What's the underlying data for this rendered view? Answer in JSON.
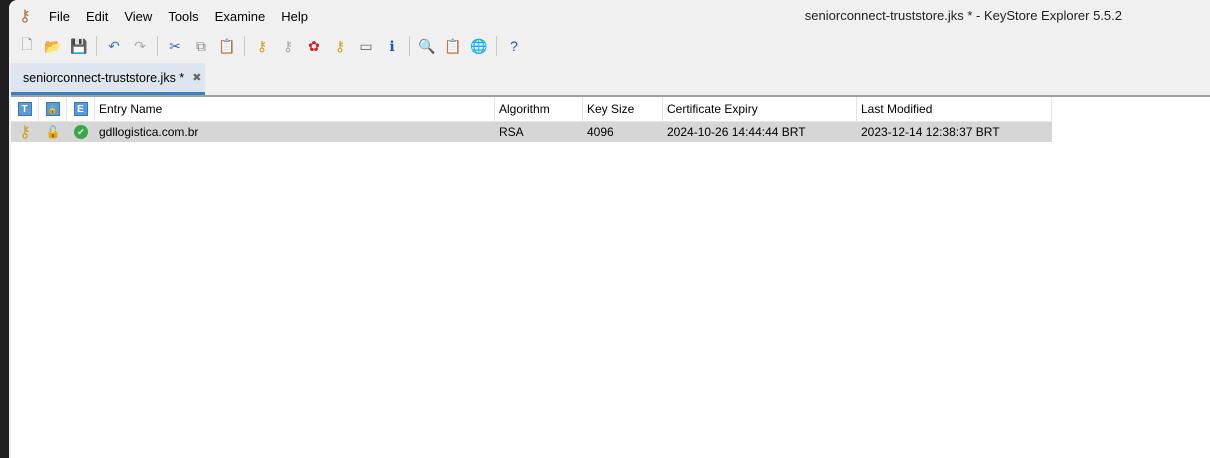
{
  "window": {
    "title": "seniorconnect-truststore.jks * - KeyStore Explorer 5.5.2"
  },
  "menu": [
    "File",
    "Edit",
    "View",
    "Tools",
    "Examine",
    "Help"
  ],
  "toolbar": [
    {
      "icon": "new-file-icon",
      "glyph": "🗋",
      "color": "#888"
    },
    {
      "icon": "open-folder-icon",
      "glyph": "📂",
      "color": "#d9a640"
    },
    {
      "icon": "save-icon",
      "glyph": "💾",
      "color": "#7a5ea8"
    },
    {
      "sep": true
    },
    {
      "icon": "undo-icon",
      "glyph": "↶",
      "color": "#3c78c0"
    },
    {
      "icon": "redo-icon",
      "glyph": "↷",
      "color": "#aaa"
    },
    {
      "sep": true
    },
    {
      "icon": "cut-icon",
      "glyph": "✂",
      "color": "#3c6fb0"
    },
    {
      "icon": "copy-icon",
      "glyph": "⧉",
      "color": "#888"
    },
    {
      "icon": "paste-icon",
      "glyph": "📋",
      "color": "#aaa"
    },
    {
      "sep": true
    },
    {
      "icon": "generate-keypair-icon",
      "glyph": "⚷",
      "color": "#c9a020"
    },
    {
      "icon": "generate-secret-key-icon",
      "glyph": "⚷",
      "color": "#aaa"
    },
    {
      "icon": "import-trusted-cert-icon",
      "glyph": "✿",
      "color": "#d02020"
    },
    {
      "icon": "import-keypair-icon",
      "glyph": "⚷",
      "color": "#c9a020"
    },
    {
      "icon": "set-password-icon",
      "glyph": "▭",
      "color": "#666"
    },
    {
      "icon": "properties-icon",
      "glyph": "ℹ",
      "color": "#2050b0"
    },
    {
      "sep": true
    },
    {
      "icon": "examine-file-icon",
      "glyph": "🔍",
      "color": "#666"
    },
    {
      "icon": "examine-clipboard-icon",
      "glyph": "📋",
      "color": "#a06030"
    },
    {
      "icon": "examine-ssl-icon",
      "glyph": "🌐",
      "color": "#2a8a9a"
    },
    {
      "sep": true
    },
    {
      "icon": "help-icon",
      "glyph": "?",
      "color": "#2050b0"
    }
  ],
  "tab": {
    "label": "seniorconnect-truststore.jks *",
    "close": "✖"
  },
  "table": {
    "icon_headers": [
      "T",
      "🔒",
      "E"
    ],
    "headers": [
      "Entry Name",
      "Algorithm",
      "Key Size",
      "Certificate Expiry",
      "Last Modified"
    ],
    "rows": [
      {
        "type_icon": "⚷",
        "lock_icon": "🔓",
        "status_icon": "✔",
        "name": "gdllogistica.com.br",
        "algorithm": "RSA",
        "key_size": "4096",
        "expiry": "2024-10-26 14:44:44 BRT",
        "modified": "2023-12-14 12:38:37 BRT"
      }
    ]
  }
}
